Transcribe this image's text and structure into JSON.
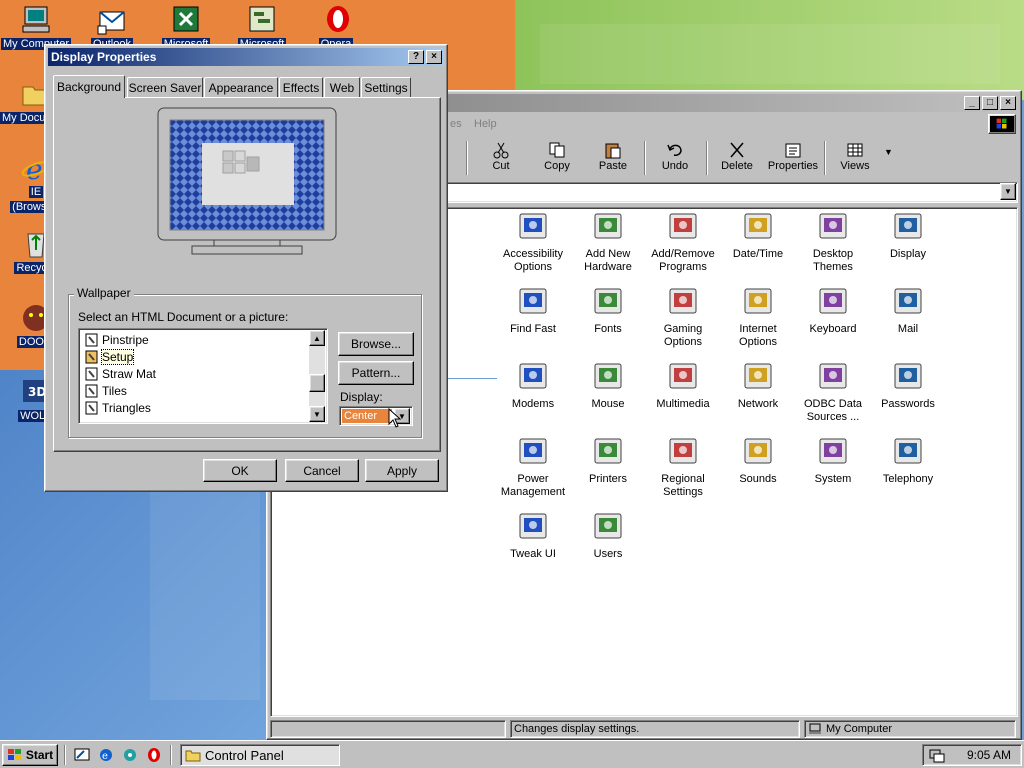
{
  "desktop": {
    "icons": [
      {
        "label": "My Computer",
        "icon": "computer-icon"
      },
      {
        "label": "Outlook",
        "icon": "outlook-icon"
      },
      {
        "label": "Microsoft",
        "icon": "excel-icon"
      },
      {
        "label": "Microsoft",
        "icon": "project-icon"
      },
      {
        "label": "Opera",
        "icon": "opera-icon"
      },
      {
        "label": "My Documents",
        "icon": "folder-icon"
      },
      {
        "label": "IE",
        "sublabel": "(Browser)",
        "icon": "ie-icon"
      },
      {
        "label": "Recycle",
        "icon": "recycle-bin-icon"
      },
      {
        "label": "DOOM",
        "icon": "doom-icon"
      },
      {
        "label": "WOLF",
        "icon": "wolf-icon"
      }
    ]
  },
  "control_panel": {
    "menu": [
      "es",
      "Help"
    ],
    "toolbar": [
      {
        "label": "Cut",
        "icon": "scissors-icon"
      },
      {
        "label": "Copy",
        "icon": "copy-icon"
      },
      {
        "label": "Paste",
        "icon": "paste-icon"
      },
      {
        "label": "Undo",
        "icon": "undo-icon"
      },
      {
        "label": "Delete",
        "icon": "delete-icon"
      },
      {
        "label": "Properties",
        "icon": "properties-icon"
      },
      {
        "label": "Views",
        "icon": "views-icon"
      }
    ],
    "items": [
      {
        "label": "Accessibility Options",
        "icon": "accessibility-icon"
      },
      {
        "label": "Add New Hardware",
        "icon": "hardware-icon"
      },
      {
        "label": "Add/Remove Programs",
        "icon": "programs-icon"
      },
      {
        "label": "Date/Time",
        "icon": "calendar-clock-icon"
      },
      {
        "label": "Desktop Themes",
        "icon": "themes-icon"
      },
      {
        "label": "Display",
        "icon": "display-icon"
      },
      {
        "label": "Find Fast",
        "icon": "binoculars-icon"
      },
      {
        "label": "Fonts",
        "icon": "fonts-folder-icon"
      },
      {
        "label": "Gaming Options",
        "icon": "joystick-icon"
      },
      {
        "label": "Internet Options",
        "icon": "globe-icon"
      },
      {
        "label": "Keyboard",
        "icon": "keyboard-icon"
      },
      {
        "label": "Mail",
        "icon": "mail-icon"
      },
      {
        "label": "Modems",
        "icon": "modem-icon"
      },
      {
        "label": "Mouse",
        "icon": "mouse-icon"
      },
      {
        "label": "Multimedia",
        "icon": "multimedia-icon"
      },
      {
        "label": "Network",
        "icon": "network-icon"
      },
      {
        "label": "ODBC Data Sources ...",
        "icon": "odbc-icon"
      },
      {
        "label": "Passwords",
        "icon": "keys-icon"
      },
      {
        "label": "Power Management",
        "icon": "power-icon"
      },
      {
        "label": "Printers",
        "icon": "printers-folder-icon"
      },
      {
        "label": "Regional Settings",
        "icon": "earth-icon"
      },
      {
        "label": "Sounds",
        "icon": "speaker-icon"
      },
      {
        "label": "System",
        "icon": "system-icon"
      },
      {
        "label": "Telephony",
        "icon": "telephone-icon"
      },
      {
        "label": "Tweak UI",
        "icon": "tweakui-icon"
      },
      {
        "label": "Users",
        "icon": "users-icon"
      }
    ],
    "status": {
      "left": "Changes display settings.",
      "right": "My Computer"
    }
  },
  "display_properties": {
    "title": "Display Properties",
    "help_btn": "?",
    "close_btn": "×",
    "tabs": [
      "Background",
      "Screen Saver",
      "Appearance",
      "Effects",
      "Web",
      "Settings"
    ],
    "group_label": "Wallpaper",
    "instruction": "Select an HTML Document or a picture:",
    "wallpapers": [
      "Pinstripe",
      "Setup",
      "Straw Mat",
      "Tiles",
      "Triangles"
    ],
    "selected_wallpaper": "Setup",
    "browse": "Browse...",
    "pattern": "Pattern...",
    "display_label": "Display:",
    "display_value": "Center",
    "ok": "OK",
    "cancel": "Cancel",
    "apply": "Apply"
  },
  "taskbar": {
    "start": "Start",
    "task": "Control Panel",
    "clock": "9:05 AM"
  },
  "colors": {
    "title_active": "#0a246a",
    "title_active_end": "#a6caf0",
    "title_inactive": "#808080",
    "face": "#c0c0c0",
    "select_orange": "#e8843c"
  }
}
